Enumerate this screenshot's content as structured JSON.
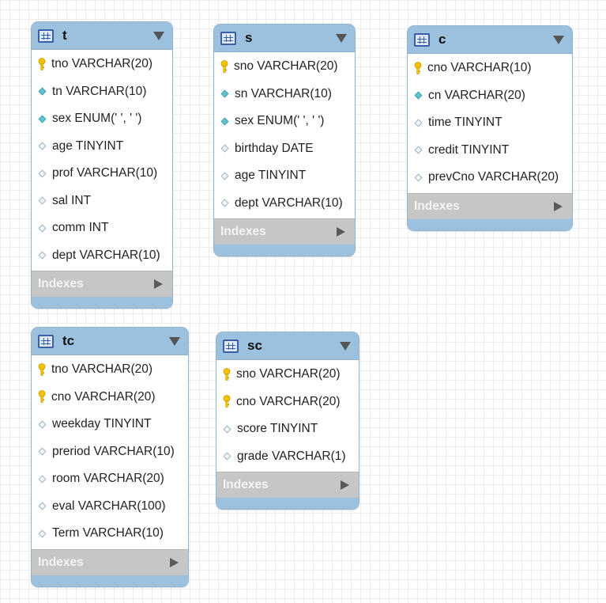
{
  "tables": [
    {
      "id": "t",
      "name": "t",
      "columns": [
        {
          "text": "tno VARCHAR(20)",
          "kind": "pk"
        },
        {
          "text": "tn VARCHAR(10)",
          "kind": "filled"
        },
        {
          "text": "sex ENUM(' ', ' ')",
          "kind": "filled"
        },
        {
          "text": "age TINYINT",
          "kind": "open"
        },
        {
          "text": "prof VARCHAR(10)",
          "kind": "open"
        },
        {
          "text": "sal INT",
          "kind": "open"
        },
        {
          "text": "comm INT",
          "kind": "open"
        },
        {
          "text": "dept VARCHAR(10)",
          "kind": "open"
        }
      ],
      "indexes_label": "Indexes"
    },
    {
      "id": "s",
      "name": "s",
      "columns": [
        {
          "text": "sno VARCHAR(20)",
          "kind": "pk"
        },
        {
          "text": "sn VARCHAR(10)",
          "kind": "filled"
        },
        {
          "text": "sex ENUM(' ', ' ')",
          "kind": "filled"
        },
        {
          "text": "birthday DATE",
          "kind": "open"
        },
        {
          "text": "age TINYINT",
          "kind": "open"
        },
        {
          "text": "dept VARCHAR(10)",
          "kind": "open"
        }
      ],
      "indexes_label": "Indexes"
    },
    {
      "id": "c",
      "name": "c",
      "columns": [
        {
          "text": "cno VARCHAR(10)",
          "kind": "pk"
        },
        {
          "text": "cn VARCHAR(20)",
          "kind": "filled"
        },
        {
          "text": "time TINYINT",
          "kind": "open"
        },
        {
          "text": "credit TINYINT",
          "kind": "open"
        },
        {
          "text": "prevCno VARCHAR(20)",
          "kind": "open"
        }
      ],
      "indexes_label": "Indexes"
    },
    {
      "id": "tc",
      "name": "tc",
      "columns": [
        {
          "text": "tno VARCHAR(20)",
          "kind": "pk"
        },
        {
          "text": "cno VARCHAR(20)",
          "kind": "pk"
        },
        {
          "text": "weekday TINYINT",
          "kind": "open"
        },
        {
          "text": "preriod VARCHAR(10)",
          "kind": "open"
        },
        {
          "text": "room VARCHAR(20)",
          "kind": "open"
        },
        {
          "text": "eval VARCHAR(100)",
          "kind": "open"
        },
        {
          "text": "Term VARCHAR(10)",
          "kind": "open"
        }
      ],
      "indexes_label": "Indexes"
    },
    {
      "id": "sc",
      "name": "sc",
      "columns": [
        {
          "text": "sno VARCHAR(20)",
          "kind": "pk"
        },
        {
          "text": "cno VARCHAR(20)",
          "kind": "pk"
        },
        {
          "text": "score TINYINT",
          "kind": "open"
        },
        {
          "text": "grade VARCHAR(1)",
          "kind": "open"
        }
      ],
      "indexes_label": "Indexes"
    }
  ],
  "icons": {
    "table": "table-icon",
    "dropdown": "dropdown-arrow-icon",
    "primary_key": "key-icon",
    "not_null_column": "filled-diamond-icon",
    "column": "open-diamond-icon",
    "expand": "expand-arrow-icon"
  },
  "colors": {
    "header": "#9cc1de",
    "indexes_bar": "#c6c6c6",
    "key": "#f2c200",
    "filled_diamond": "#5fc6cf"
  }
}
